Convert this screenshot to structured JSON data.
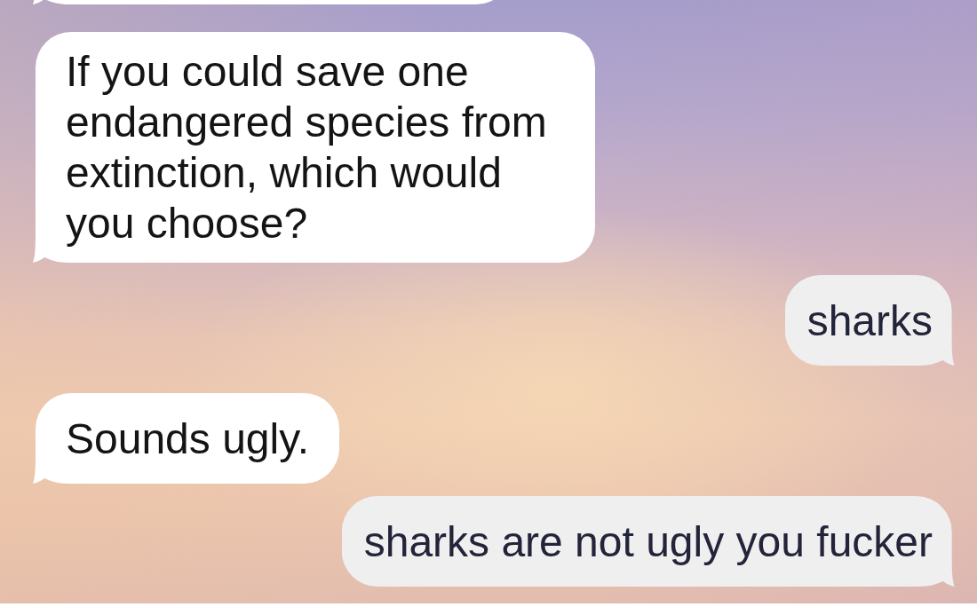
{
  "messages": [
    {
      "kind": "incoming"
    },
    {
      "kind": "incoming",
      "text": "If you could save one endangered species from extinction, which would you choose?"
    },
    {
      "kind": "outgoing",
      "text": "sharks"
    },
    {
      "kind": "incoming",
      "text": "Sounds ugly."
    },
    {
      "kind": "outgoing",
      "text": "sharks are not ugly you fucker"
    }
  ]
}
